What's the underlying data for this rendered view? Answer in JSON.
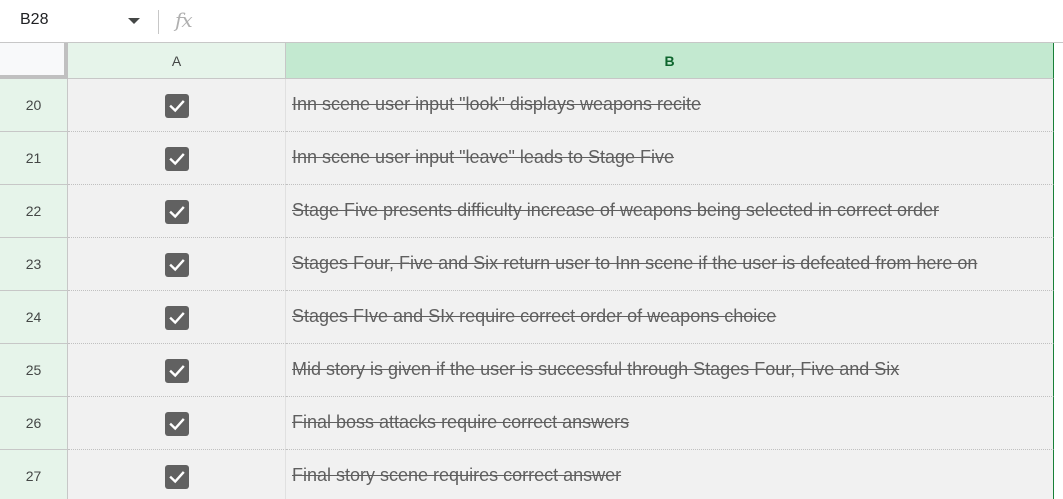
{
  "formula_bar": {
    "cell_reference": "B28",
    "fx_label": "fx"
  },
  "columns": [
    {
      "label": "A"
    },
    {
      "label": "B"
    }
  ],
  "rows": [
    {
      "number": "20",
      "checked": true,
      "text": "Inn scene user input \"look\" displays weapons recite"
    },
    {
      "number": "21",
      "checked": true,
      "text": "Inn scene user input \"leave\" leads to Stage Five"
    },
    {
      "number": "22",
      "checked": true,
      "text": "Stage Five presents difficulty increase of weapons being selected in correct order"
    },
    {
      "number": "23",
      "checked": true,
      "text": "Stages Four, Five and Six return user to Inn scene if the user is defeated from here on"
    },
    {
      "number": "24",
      "checked": true,
      "text": "Stages FIve and SIx require correct order of weapons choice"
    },
    {
      "number": "25",
      "checked": true,
      "text": "Mid story is given if the user is successful through Stages Four, Five and Six"
    },
    {
      "number": "26",
      "checked": true,
      "text": "Final boss attacks require correct answers"
    },
    {
      "number": "27",
      "checked": true,
      "text": "Final story scene requires correct answer"
    }
  ],
  "colors": {
    "header_selected": "#c3e9d0",
    "header_tint": "#e6f4ea",
    "checkbox": "#616161"
  }
}
